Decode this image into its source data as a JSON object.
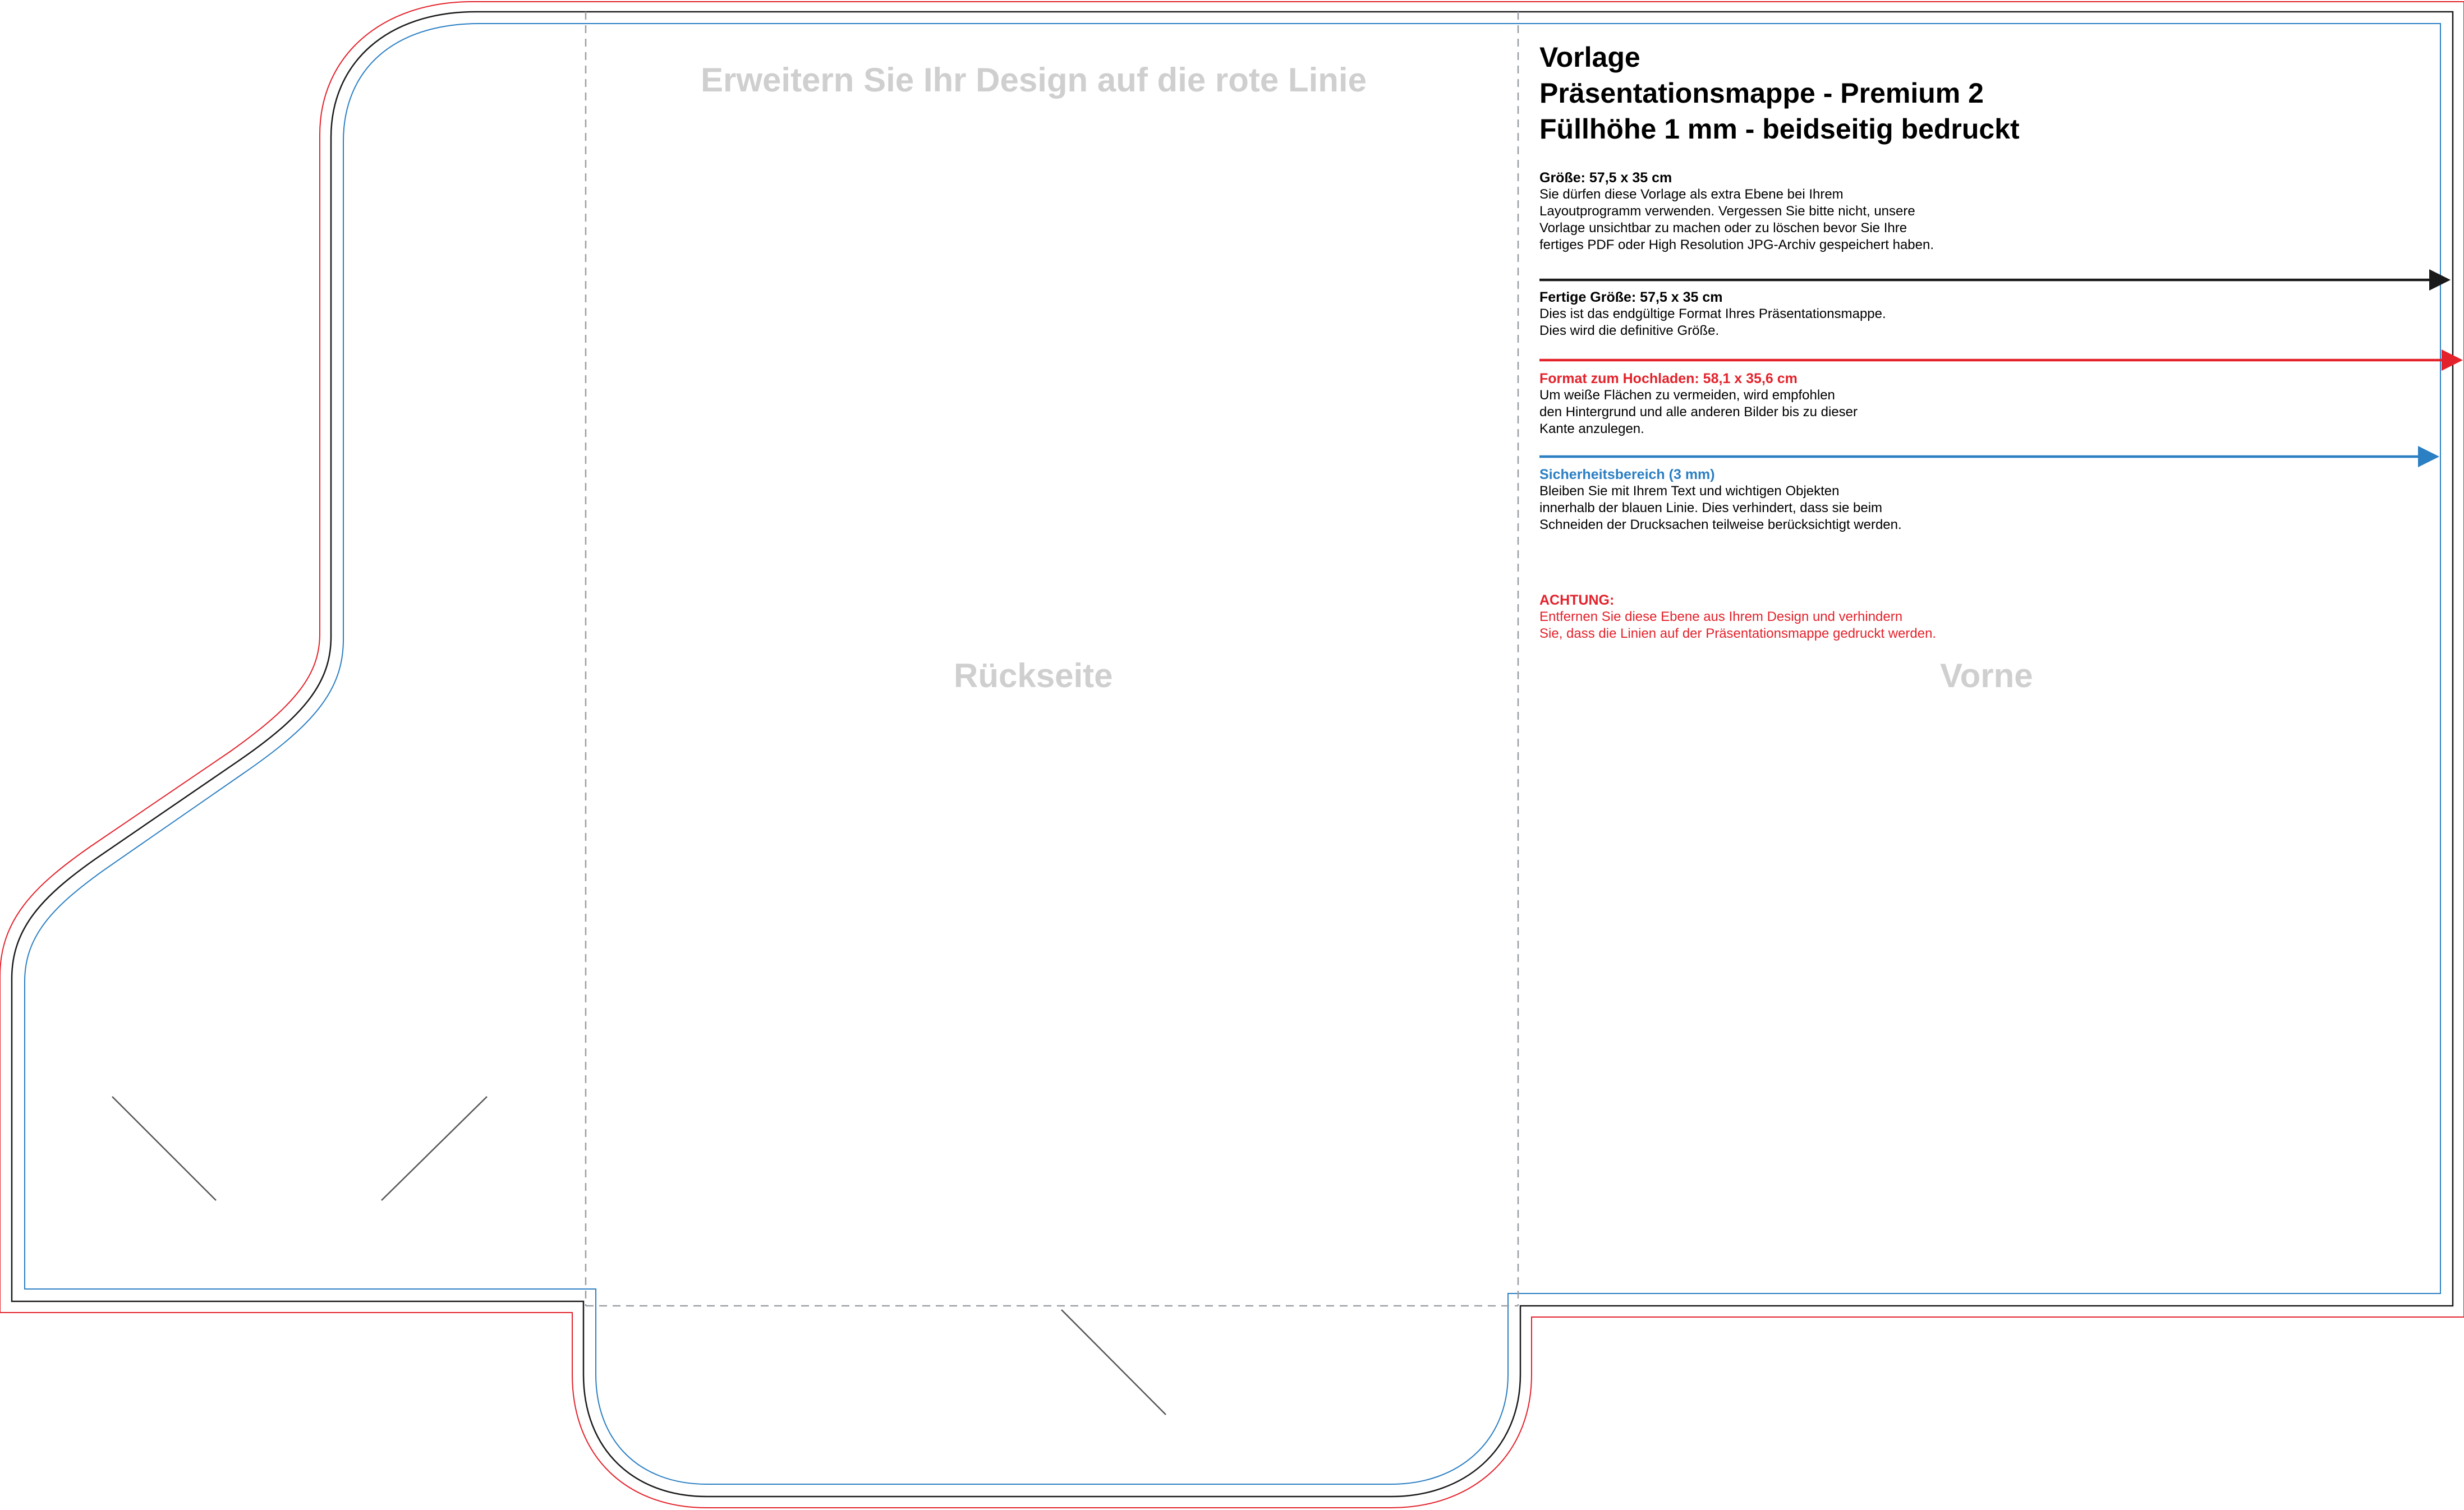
{
  "template": {
    "title_lines": [
      "Vorlage",
      "Präsentationsmappe - Premium 2",
      "Füllhöhe 1 mm - beidseitig bedruckt"
    ],
    "extend_hint": "Erweitern Sie Ihr Design auf die rote Linie",
    "panel_back_label": "Rückseite",
    "panel_front_label": "Vorne"
  },
  "info": {
    "size_heading": "Größe: 57,5 x 35 cm",
    "size_text": [
      "Sie dürfen diese Vorlage als extra Ebene bei Ihrem",
      "Layoutprogramm verwenden. Vergessen Sie bitte nicht, unsere",
      "Vorlage unsichtbar zu machen oder zu löschen bevor Sie Ihre",
      "fertiges PDF oder High Resolution JPG-Archiv gespeichert haben."
    ],
    "final_heading": "Fertige Größe: 57,5 x 35 cm",
    "final_text": [
      "Dies ist das endgültige Format Ihres Präsentationsmappe.",
      "Dies wird die definitive Größe."
    ],
    "upload_heading": "Format zum Hochladen: 58,1 x 35,6 cm",
    "upload_text": [
      "Um weiße Flächen zu vermeiden, wird empfohlen",
      "den Hintergrund und alle anderen Bilder bis zu dieser",
      "Kante anzulegen."
    ],
    "safety_heading": "Sicherheitsbereich (3 mm)",
    "safety_text": [
      "Bleiben Sie mit Ihrem Text und wichtigen Objekten",
      "innerhalb der blauen Linie. Dies verhindert, dass sie beim",
      "Schneiden der Drucksachen teilweise berücksichtigt werden."
    ],
    "warning_heading": "ACHTUNG:",
    "warning_text": [
      "Entfernen Sie diese Ebene aus Ihrem Design und verhindern",
      "Sie, dass die Linien auf der Präsentationsmappe gedruckt werden."
    ]
  },
  "colors": {
    "cut_line": "#1a1a1a",
    "bleed_line": "#e3222b",
    "safety_line": "#2b7fc3",
    "fold_line": "#9aa0a6",
    "ghost_text": "#cfcfcf"
  }
}
